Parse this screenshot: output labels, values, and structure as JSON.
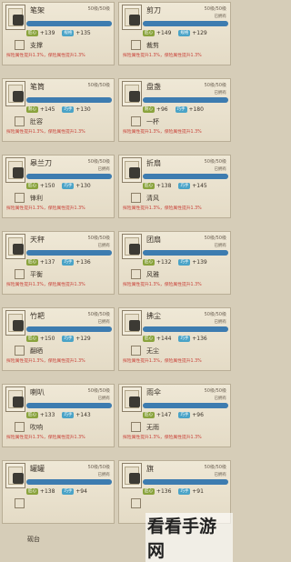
{
  "cards": [
    {
      "name": "笔架",
      "level": "50级/50级",
      "obtained": "",
      "stat1": "+139",
      "stat2": "+135",
      "tag1": "匠心",
      "tag2": "规格",
      "skill": "支撑",
      "boost": "探险属性提升1.3%，保险属性提升1.3%",
      "fill": 1.0
    },
    {
      "name": "剪刀",
      "level": "50级/50级",
      "obtained": "已拥有",
      "stat1": "+149",
      "stat2": "+129",
      "tag1": "匠心",
      "tag2": "规格",
      "skill": "裁剪",
      "boost": "探险属性提升1.3%，保险属性提升1.3%",
      "fill": 1.0
    },
    {
      "name": "笔筒",
      "level": "50级/50级",
      "obtained": "",
      "stat1": "+145",
      "stat2": "+130",
      "tag1": "耐心",
      "tag2": "巧手",
      "skill": "肚容",
      "boost": "探险属性提升1.3%，保险属性提升1.3%",
      "fill": 1.0
    },
    {
      "name": "盘盏",
      "level": "50级/50级",
      "obtained": "已拥有",
      "stat1": "+96",
      "stat2": "+180",
      "tag1": "耐心",
      "tag2": "巧手",
      "skill": "一杯",
      "boost": "探险属性提升1.3%，保险属性提升1.3%",
      "fill": 1.0
    },
    {
      "name": "皋兰刀",
      "level": "50级/50级",
      "obtained": "已拥有",
      "stat1": "+150",
      "stat2": "+130",
      "tag1": "匠心",
      "tag2": "巧手",
      "skill": "锋利",
      "boost": "探险属性提升1.3%，保险属性提升1.3%",
      "fill": 1.0
    },
    {
      "name": "折扇",
      "level": "50级/50级",
      "obtained": "已拥有",
      "stat1": "+138",
      "stat2": "+145",
      "tag1": "匠心",
      "tag2": "巧手",
      "skill": "清风",
      "boost": "探险属性提升1.3%，保险属性提升1.3%",
      "fill": 1.0
    },
    {
      "name": "天秤",
      "level": "50级/50级",
      "obtained": "已拥有",
      "stat1": "+137",
      "stat2": "+136",
      "tag1": "匠心",
      "tag2": "巧手",
      "skill": "平衡",
      "boost": "探险属性提升1.3%，保险属性提升1.3%",
      "fill": 1.0
    },
    {
      "name": "团扇",
      "level": "50级/50级",
      "obtained": "已拥有",
      "stat1": "+132",
      "stat2": "+139",
      "tag1": "匠心",
      "tag2": "巧手",
      "skill": "风雅",
      "boost": "探险属性提升1.3%，保险属性提升1.3%",
      "fill": 1.0
    },
    {
      "name": "竹耙",
      "level": "50级/50级",
      "obtained": "已拥有",
      "stat1": "+150",
      "stat2": "+129",
      "tag1": "匠心",
      "tag2": "巧手",
      "skill": "翻晒",
      "boost": "探险属性提升1.3%，保险属性提升1.3%",
      "fill": 1.0
    },
    {
      "name": "拂尘",
      "level": "50级/50级",
      "obtained": "已拥有",
      "stat1": "+144",
      "stat2": "+136",
      "tag1": "匠心",
      "tag2": "巧手",
      "skill": "无尘",
      "boost": "探险属性提升1.3%，保险属性提升1.3%",
      "fill": 1.0
    },
    {
      "name": "喇叭",
      "level": "50级/50级",
      "obtained": "已拥有",
      "stat1": "+133",
      "stat2": "+143",
      "tag1": "匠心",
      "tag2": "巧手",
      "skill": "吹响",
      "boost": "探险属性提升1.3%，保险属性提升1.3%",
      "fill": 1.0
    },
    {
      "name": "雨伞",
      "level": "50级/50级",
      "obtained": "已拥有",
      "stat1": "+147",
      "stat2": "+96",
      "tag1": "匠心",
      "tag2": "巧手",
      "skill": "无雨",
      "boost": "探险属性提升1.3%，保险属性提升1.3%",
      "fill": 1.0
    },
    {
      "name": "罐罐",
      "level": "50级/50级",
      "obtained": "已拥有",
      "stat1": "+138",
      "stat2": "+94",
      "tag1": "匠心",
      "tag2": "巧手",
      "skill": "",
      "boost": "",
      "fill": 1.0
    },
    {
      "name": "旗",
      "level": "50级/50级",
      "obtained": "已拥有",
      "stat1": "+136",
      "stat2": "+91",
      "tag1": "匠心",
      "tag2": "巧手",
      "skill": "",
      "boost": "",
      "fill": 1.0
    }
  ],
  "footer": {
    "label": "砚台"
  },
  "watermark": {
    "text": "看看手游网"
  }
}
